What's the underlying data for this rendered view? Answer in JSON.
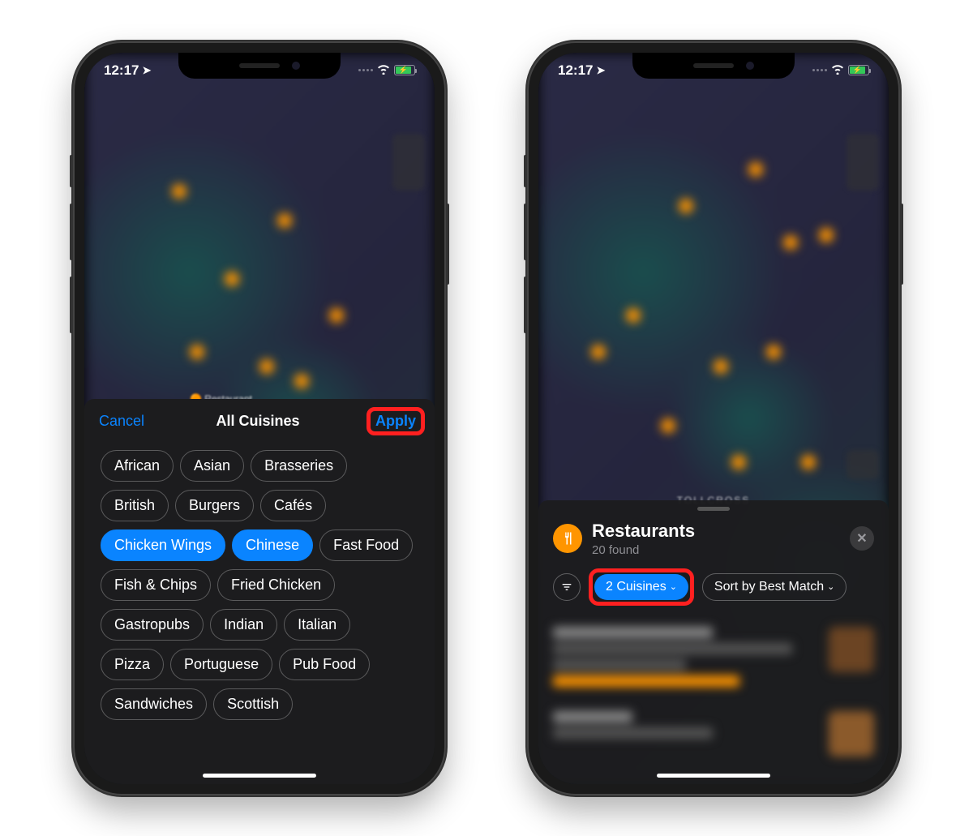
{
  "status": {
    "time": "12:17",
    "location_indicator": "➤"
  },
  "left": {
    "map_label": "Restaurant",
    "sheet": {
      "cancel_label": "Cancel",
      "title": "All Cuisines",
      "apply_label": "Apply",
      "cuisines": [
        {
          "label": "African",
          "selected": false
        },
        {
          "label": "Asian",
          "selected": false
        },
        {
          "label": "Brasseries",
          "selected": false
        },
        {
          "label": "British",
          "selected": false
        },
        {
          "label": "Burgers",
          "selected": false
        },
        {
          "label": "Cafés",
          "selected": false
        },
        {
          "label": "Chicken Wings",
          "selected": true
        },
        {
          "label": "Chinese",
          "selected": true
        },
        {
          "label": "Fast Food",
          "selected": false
        },
        {
          "label": "Fish & Chips",
          "selected": false
        },
        {
          "label": "Fried Chicken",
          "selected": false
        },
        {
          "label": "Gastropubs",
          "selected": false
        },
        {
          "label": "Indian",
          "selected": false
        },
        {
          "label": "Italian",
          "selected": false
        },
        {
          "label": "Pizza",
          "selected": false
        },
        {
          "label": "Portuguese",
          "selected": false
        },
        {
          "label": "Pub Food",
          "selected": false
        },
        {
          "label": "Sandwiches",
          "selected": false
        },
        {
          "label": "Scottish",
          "selected": false
        }
      ]
    }
  },
  "right": {
    "location_text": "TOLLCROSS",
    "results": {
      "title": "Restaurants",
      "subtitle": "20 found",
      "cuisine_filter_label": "2 Cuisines",
      "sort_label": "Sort by Best Match"
    }
  }
}
